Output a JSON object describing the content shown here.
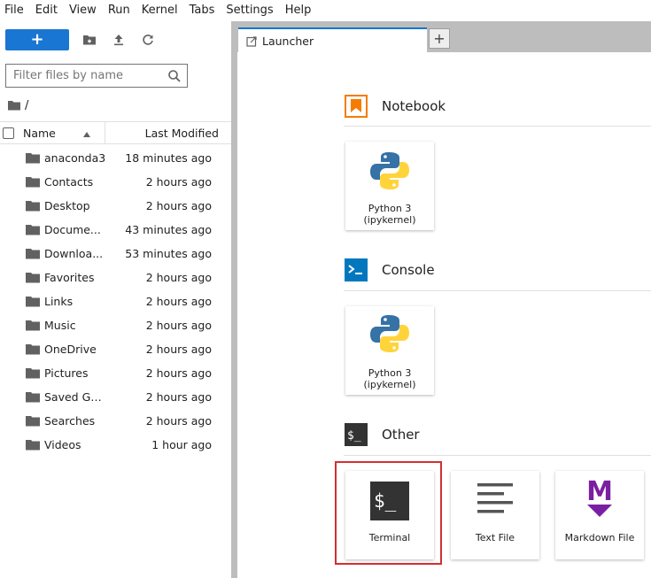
{
  "menubar": [
    "File",
    "Edit",
    "View",
    "Run",
    "Kernel",
    "Tabs",
    "Settings",
    "Help"
  ],
  "filebrowser": {
    "new_label": "+",
    "filter_placeholder": "Filter files by name",
    "breadcrumb": "/",
    "columns": {
      "name": "Name",
      "modified": "Last Modified"
    },
    "files": [
      {
        "name": "anaconda3",
        "modified": "18 minutes ago"
      },
      {
        "name": "Contacts",
        "modified": "2 hours ago"
      },
      {
        "name": "Desktop",
        "modified": "2 hours ago"
      },
      {
        "name": "Docume...",
        "modified": "43 minutes ago"
      },
      {
        "name": "Downloa...",
        "modified": "53 minutes ago"
      },
      {
        "name": "Favorites",
        "modified": "2 hours ago"
      },
      {
        "name": "Links",
        "modified": "2 hours ago"
      },
      {
        "name": "Music",
        "modified": "2 hours ago"
      },
      {
        "name": "OneDrive",
        "modified": "2 hours ago"
      },
      {
        "name": "Pictures",
        "modified": "2 hours ago"
      },
      {
        "name": "Saved Ga...",
        "modified": "2 hours ago"
      },
      {
        "name": "Searches",
        "modified": "2 hours ago"
      },
      {
        "name": "Videos",
        "modified": "1 hour ago"
      }
    ]
  },
  "tabs": {
    "launcher": "Launcher",
    "add": "+"
  },
  "launcher": {
    "notebook": {
      "title": "Notebook",
      "card": "Python 3 (ipykernel)"
    },
    "console": {
      "title": "Console",
      "card": "Python 3 (ipykernel)"
    },
    "other": {
      "title": "Other",
      "terminal": "Terminal",
      "textfile": "Text File",
      "markdown": "Markdown File"
    }
  },
  "colors": {
    "accent": "#1976d2",
    "notebook_orange": "#f57c00",
    "console_blue": "#0277bd",
    "markdown_purple": "#7b1fa2",
    "highlight_red": "#d32f2f"
  }
}
